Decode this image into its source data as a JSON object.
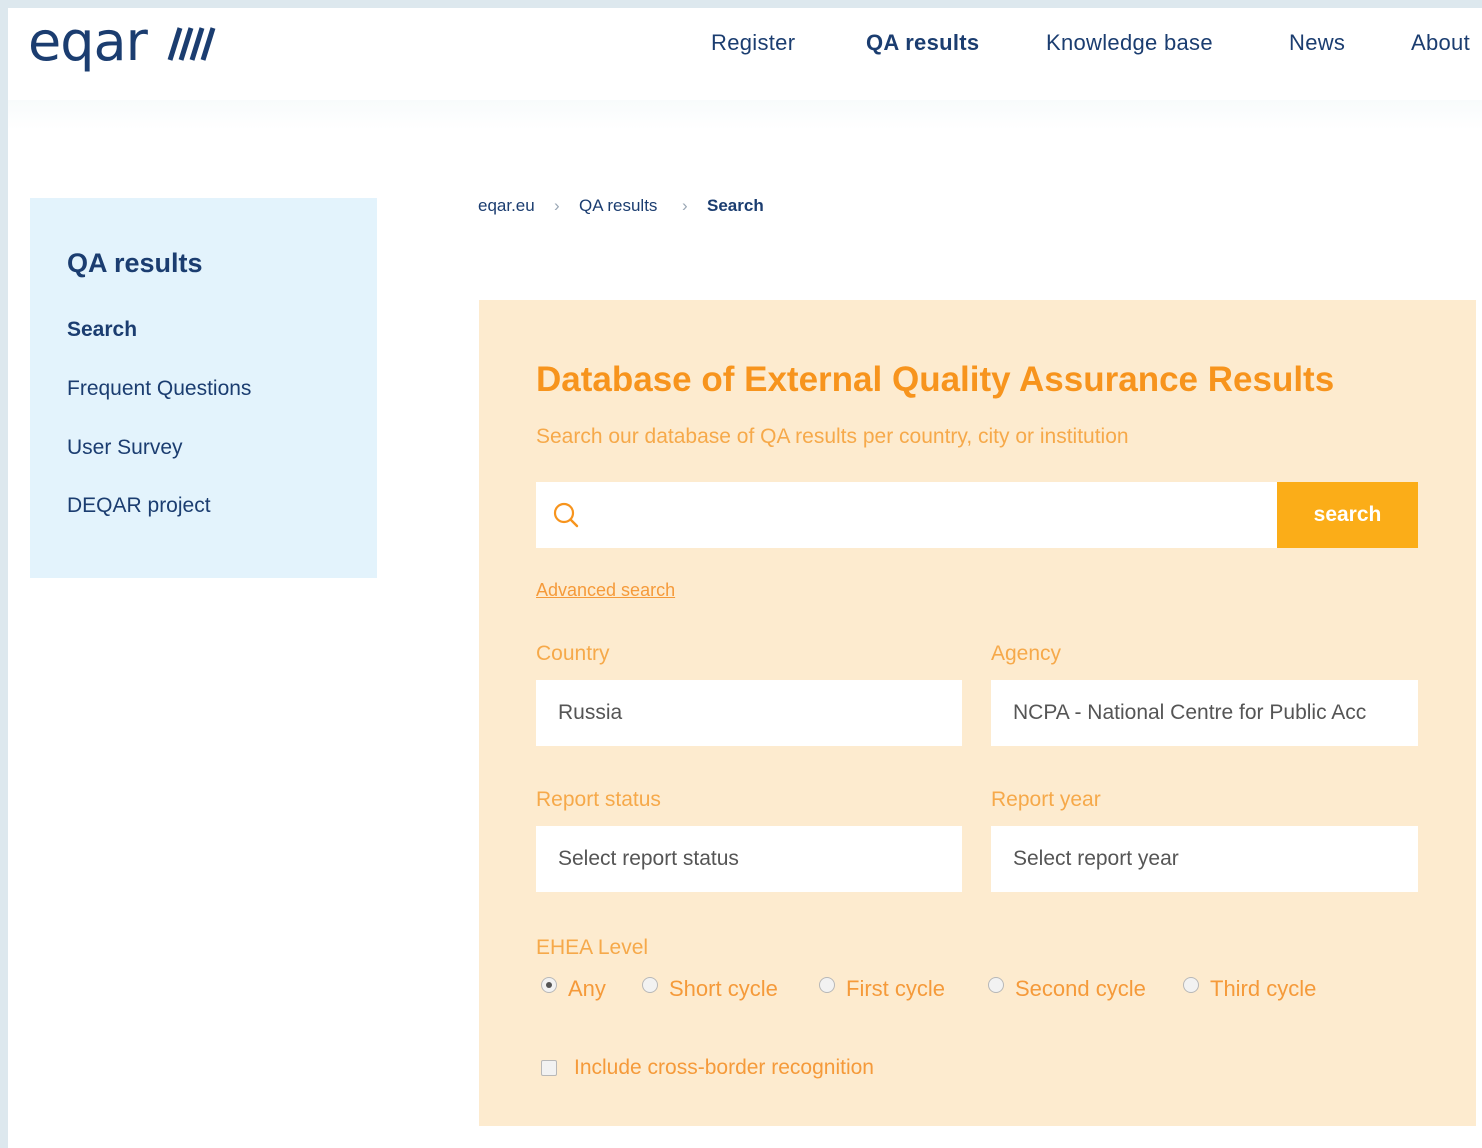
{
  "header": {
    "logo_text": "eqar",
    "nav": [
      "Register",
      "QA results",
      "Knowledge base",
      "News",
      "About"
    ],
    "active_nav": "QA results"
  },
  "sidebar": {
    "title": "QA results",
    "items": [
      "Search",
      "Frequent Questions",
      "User Survey",
      "DEQAR project"
    ]
  },
  "breadcrumb": [
    "eqar.eu",
    "QA results",
    "Search"
  ],
  "panel": {
    "title": "Database of External Quality Assurance Results",
    "subtitle": "Search our database of QA results per country, city or institution",
    "search_button": "search",
    "advanced_link": "Advanced search",
    "country_label": "Country",
    "country_value": "Russia",
    "agency_label": "Agency",
    "agency_value": "NCPA - National Centre for Public Acc",
    "status_label": "Report status",
    "status_placeholder": "Select report status",
    "year_label": "Report year",
    "year_placeholder": "Select report year",
    "ehea_label": "EHEA Level",
    "ehea_options": [
      "Any",
      "Short cycle",
      "First cycle",
      "Second cycle",
      "Third cycle"
    ],
    "ehea_selected": "Any",
    "crossborder_label": "Include cross-border recognition"
  },
  "colors": {
    "navy": "#1b3d70",
    "orange": "#f7941d",
    "button": "#fbad18",
    "panel_bg": "#fdebcf",
    "sidebar_bg": "#e3f3fc"
  }
}
